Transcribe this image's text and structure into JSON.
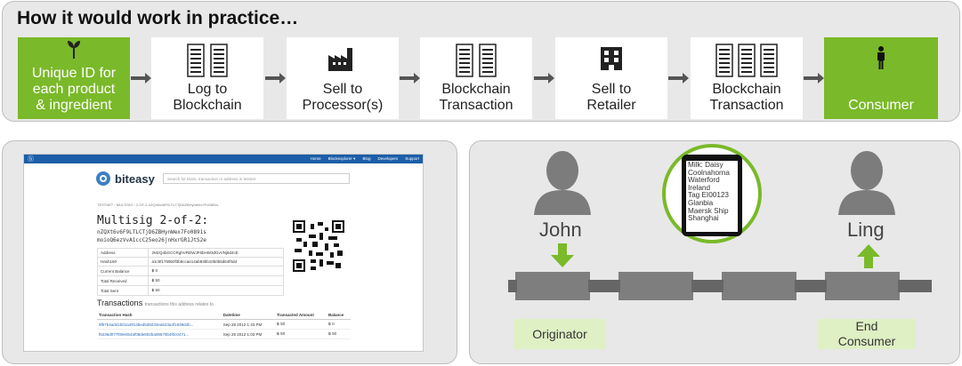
{
  "headline": "How it would work in practice…",
  "steps": [
    {
      "label1": "Unique ID for",
      "label2": "each product",
      "label3": "& ingredient",
      "icon": "sprout-icon",
      "green": true
    },
    {
      "label1": "Log to",
      "label2": "Blockchain",
      "icon": "ledger-icon"
    },
    {
      "label1": "Sell to",
      "label2": "Processor(s)",
      "icon": "factory-icon"
    },
    {
      "label1": "Blockchain",
      "label2": "Transaction",
      "icon": "ledger-icon"
    },
    {
      "label1": "Sell to",
      "label2": "Retailer",
      "icon": "store-icon"
    },
    {
      "label1": "Blockchain",
      "label2": "Transaction",
      "icon": "ledger-icon"
    },
    {
      "label1": "Consumer",
      "icon": "person-icon",
      "green": true
    }
  ],
  "explorer": {
    "nav_links": [
      "Home",
      "Blockexplorer ▾",
      "Blog",
      "Developers",
      "Support"
    ],
    "brand": "biteasy",
    "search_placeholder": "Search for block, transaction or address in testnet",
    "breadcrumb": "TESTNET  ›  MULTISIG  ›  2-OF-2-nZQXt6v6F9LTLCTjD6ZBHynWex7Fo0891s",
    "title": "Multisig 2-of-2:",
    "addr1": "nZQXt6v6F9LTLCTjD6ZBHynWex7Fo0891s",
    "addr2": "moioQ6ezVvA1ccC25eo26jnHxrGR1JtS2e",
    "info_rows": [
      {
        "k": "Address",
        "v": "2MzQ4bGCCRghVRDWJF6bHW3dGvVNj8d4cE"
      },
      {
        "k": "Hash160",
        "v": "a1c5f1759b0f3b9ccae14ab93bb10b0b5d64f0dd"
      },
      {
        "k": "Current Balance",
        "v": "฿ 0"
      },
      {
        "k": "Total Received",
        "v": "฿ 50"
      },
      {
        "k": "Total Sent",
        "v": "฿ 50"
      }
    ],
    "tx_title": "Transactions",
    "tx_subtitle": "transactions this address relates to",
    "tx_headers": [
      "Transaction Hash",
      "Datetime",
      "Transacted Amount",
      "Balance"
    ],
    "tx_rows": [
      {
        "hash": "9f57b4ad41b01a4913bed5d5033ea623a4f1939d4b...",
        "date": "Sep 28 2012 1:33 PM",
        "amount": "฿ 50",
        "balance": "฿ 0"
      },
      {
        "hash": "f6236d077f09e0b4af08de802ba08670b4f0c0471...",
        "date": "Sep 25 2012 1:03 PM",
        "amount": "฿ 50",
        "balance": "฿ 50"
      }
    ]
  },
  "chain": {
    "originator_name": "John",
    "consumer_name": "Ling",
    "originator_label": "Originator",
    "consumer_label1": "End",
    "consumer_label2": "Consumer",
    "phone_lines": [
      "Milk: Daisy",
      "Coolnahorna",
      "Waterford",
      "Ireland",
      "Tag EI00123",
      "Glanbia",
      "Maersk Ship",
      "Shanghai"
    ]
  },
  "colors": {
    "green": "#7ab929",
    "light_green": "#dff0c4",
    "panel": "#e8e8e8",
    "arrow": "#555555"
  }
}
